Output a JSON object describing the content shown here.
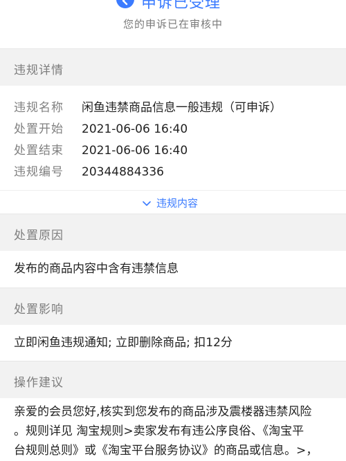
{
  "status": {
    "title": "申诉已受理",
    "subtitle": "您的申诉已在审核中",
    "accent_color": "#3b7bff",
    "icon": "chevron-left-icon"
  },
  "violation_details": {
    "heading": "违规详情",
    "rows": [
      {
        "label": "违规名称",
        "value": "闲鱼违禁商品信息一般违规（可申诉）"
      },
      {
        "label": "处置开始",
        "value": "2021-06-06 16:40"
      },
      {
        "label": "处置结束",
        "value": "2021-06-06 16:40"
      },
      {
        "label": "违规编号",
        "value": "20344884336"
      }
    ],
    "expand_label": "违规内容",
    "expand_icon": "chevron-down-icon"
  },
  "reason": {
    "heading": "处置原因",
    "text": "发布的商品内容中含有违禁信息"
  },
  "impact": {
    "heading": "处置影响",
    "text": "立即闲鱼违规通知; 立即删除商品; 扣12分"
  },
  "advice": {
    "heading": "操作建议",
    "lines": [
      "亲爱的会员您好,核实到您发布的商品涉及震楼器违禁风险",
      "。规则详见 淘宝规则>卖家发布有违公序良俗、《淘宝平",
      "台规则总则》或《淘宝平台服务协议》的商品或信息。>，"
    ]
  }
}
